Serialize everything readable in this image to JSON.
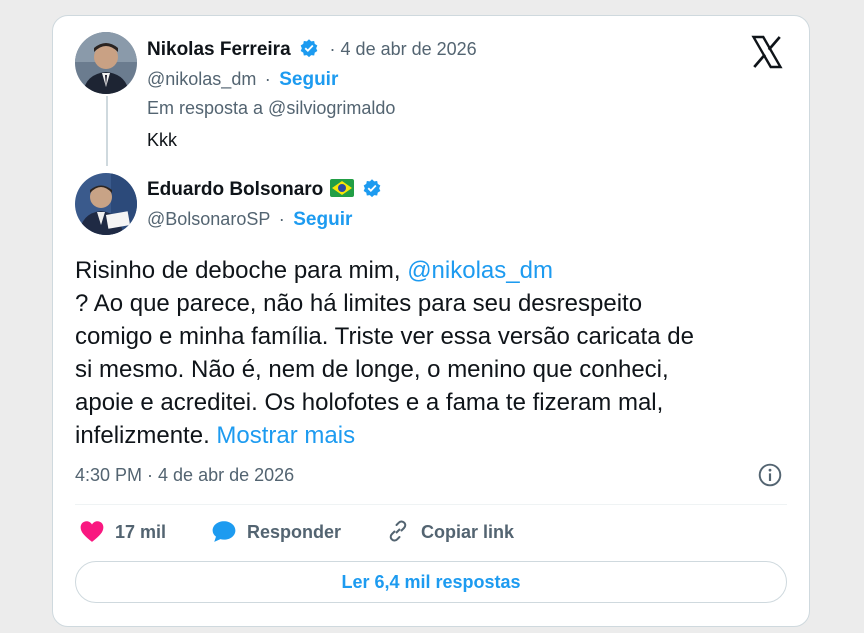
{
  "reply_to_tweet": {
    "author_name": "Nikolas Ferreira",
    "date": "· 4 de abr de 2026",
    "handle": "@nikolas_dm",
    "separator": "·",
    "follow_label": "Seguir",
    "in_reply_to": "Em resposta a @silviogrimaldo",
    "text": "Kkk"
  },
  "main_tweet": {
    "author_name": "Eduardo Bolsonaro",
    "handle": "@BolsonaroSP",
    "separator": "·",
    "follow_label": "Seguir",
    "text_part1": "Risinho de deboche para mim, ",
    "mention": "@nikolas_dm",
    "text_line2": "? Ao que parece, não há limites para seu desrespeito",
    "text_line3": "comigo e minha família. Triste ver essa versão caricata de",
    "text_line4": "si mesmo. Não é, nem de longe, o menino que conheci,",
    "text_line5": "apoie e acreditei. Os holofotes e a fama te fizeram mal,",
    "text_line6": "infelizmente. ",
    "show_more": "Mostrar mais",
    "timestamp": "4:30 PM · 4 de abr de 2026"
  },
  "actions": {
    "likes": "17 mil",
    "reply_label": "Responder",
    "copy_link_label": "Copiar link"
  },
  "read_replies_label": "Ler 6,4 mil respostas",
  "colors": {
    "accent": "#1d9bf0",
    "like": "#f91880",
    "text": "#0f1419",
    "muted": "#536471"
  },
  "icons": [
    "x-logo-icon",
    "verified-badge-icon",
    "brazil-flag-icon",
    "info-icon",
    "heart-icon",
    "reply-bubble-icon",
    "link-icon"
  ]
}
